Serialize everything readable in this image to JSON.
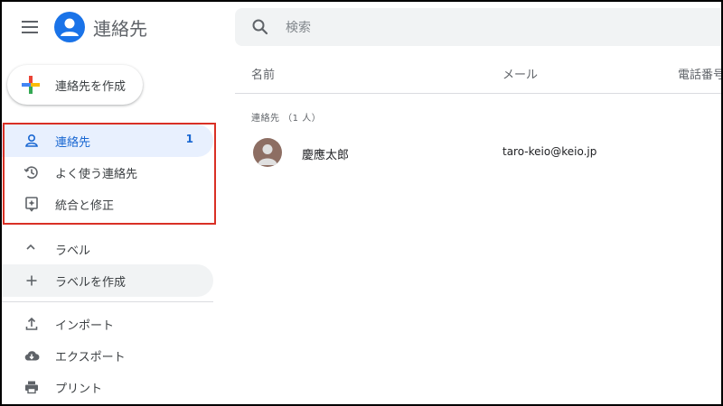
{
  "app": {
    "title": "連絡先",
    "accent_color": "#1a73e8"
  },
  "search": {
    "placeholder": "検索",
    "value": ""
  },
  "sidebar": {
    "create_label": "連絡先を作成",
    "items": [
      {
        "label": "連絡先",
        "count": "1",
        "icon": "person-icon",
        "active": true
      },
      {
        "label": "よく使う連絡先",
        "icon": "history-icon"
      },
      {
        "label": "統合と修正",
        "icon": "merge-fix-icon"
      }
    ],
    "labels_section": {
      "label": "ラベル",
      "icon": "chevron-up-icon"
    },
    "create_label_item": {
      "label": "ラベルを作成",
      "icon": "plus-icon"
    },
    "bottom_items": [
      {
        "label": "インポート",
        "icon": "upload-icon"
      },
      {
        "label": "エクスポート",
        "icon": "cloud-download-icon"
      },
      {
        "label": "プリント",
        "icon": "printer-icon"
      }
    ]
  },
  "list": {
    "columns": [
      "名前",
      "メール",
      "電話番号"
    ],
    "group_title": "連絡先 （1 人）",
    "rows": [
      {
        "name": "慶應太郎",
        "email": "taro-keio@keio.jp"
      }
    ]
  },
  "highlight_color": "#d93025"
}
